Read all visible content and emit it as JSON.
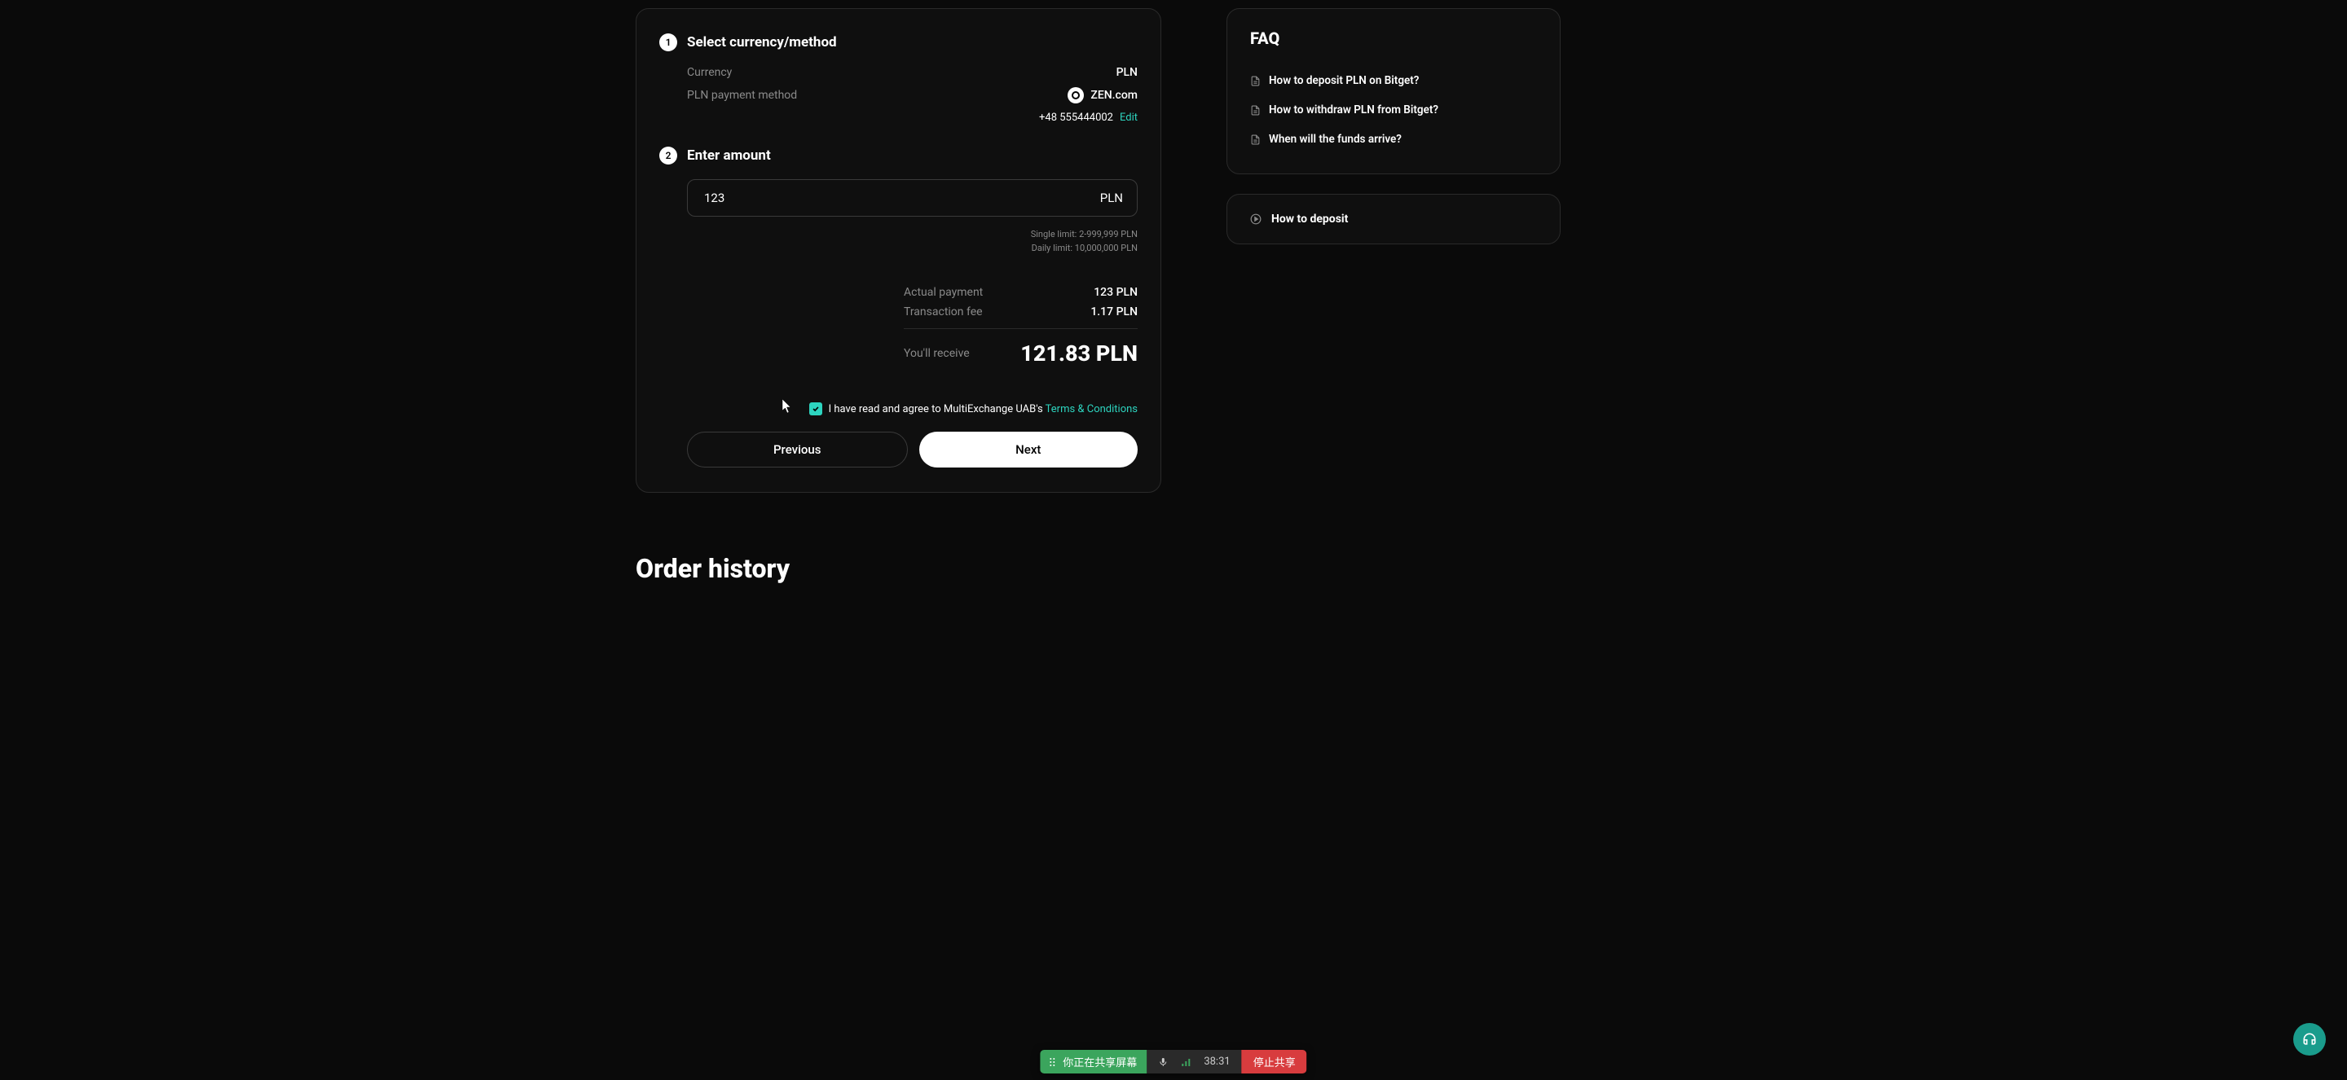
{
  "step1": {
    "title": "Select currency/method",
    "currency_label": "Currency",
    "currency_value": "PLN",
    "method_label": "PLN payment method",
    "method_value": "ZEN.com",
    "phone": "+48  555444002",
    "edit": "Edit"
  },
  "step2": {
    "title": "Enter amount",
    "input_value": "123",
    "input_suffix": "PLN",
    "single_limit": "Single limit: 2-999,999 PLN",
    "daily_limit": "Daily limit: 10,000,000 PLN",
    "actual_label": "Actual payment",
    "actual_value": "123 PLN",
    "fee_label": "Transaction fee",
    "fee_value": "1.17 PLN",
    "receive_label": "You'll receive",
    "receive_value": "121.83 PLN"
  },
  "agreement": {
    "text": "I have read and agree to MultiExchange UAB's ",
    "link": "Terms & Conditions"
  },
  "buttons": {
    "previous": "Previous",
    "next": "Next"
  },
  "faq": {
    "title": "FAQ",
    "items": [
      "How to deposit PLN on Bitget?",
      "How to withdraw PLN from Bitget?",
      "When will the funds arrive?"
    ]
  },
  "video": {
    "label": "How to deposit"
  },
  "order_history": "Order history",
  "share_bar": {
    "sharing_text": "你正在共享屏幕",
    "time": "38:31",
    "stop": "停止共享"
  }
}
